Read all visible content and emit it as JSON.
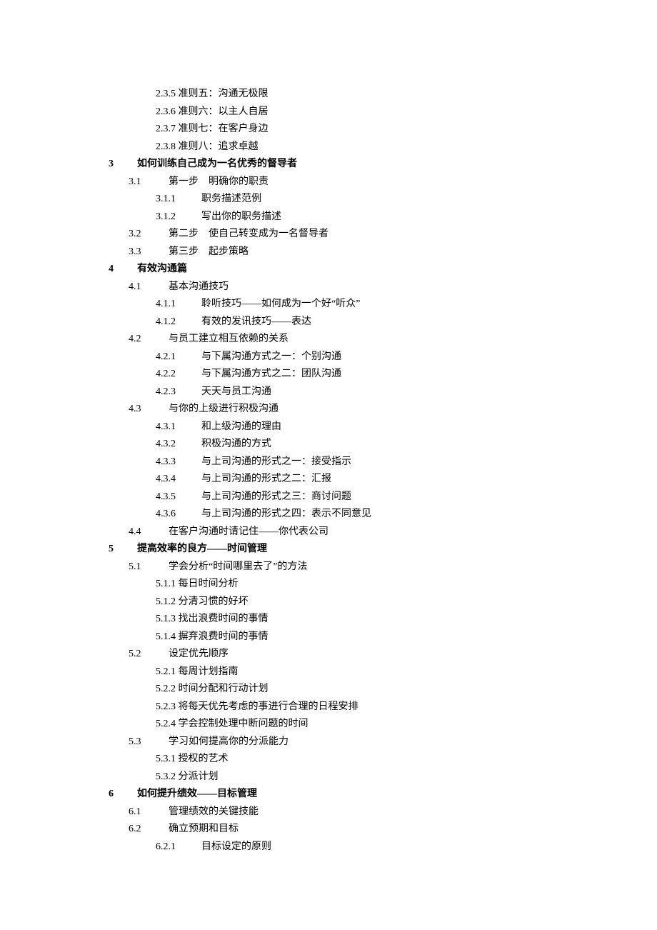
{
  "pre_items": [
    "2.3.5 准则五：沟通无极限",
    "2.3.6 准则六：以主人自居",
    "2.3.7 准则七：在客户身边",
    "2.3.8 准则八：追求卓越"
  ],
  "sections": [
    {
      "num": "3",
      "title": "如何训练自己成为一名优秀的督导者",
      "subs": [
        {
          "num": "3.1",
          "title": "第一步　明确你的职责",
          "items_style": "spaced",
          "items": [
            {
              "num": "3.1.1",
              "text": "职务描述范例"
            },
            {
              "num": "3.1.2",
              "text": "写出你的职务描述"
            }
          ]
        },
        {
          "num": "3.2",
          "title": "第二步　使自己转变成为一名督导者",
          "items": []
        },
        {
          "num": "3.3",
          "title": "第三步　起步策略",
          "items": []
        }
      ]
    },
    {
      "num": "4",
      "title": "有效沟通篇",
      "subs": [
        {
          "num": "4.1",
          "title": "基本沟通技巧",
          "items_style": "spaced",
          "items": [
            {
              "num": "4.1.1",
              "text": "聆听技巧——如何成为一个好“听众”"
            },
            {
              "num": "4.1.2",
              "text": "有效的发讯技巧——表达"
            }
          ]
        },
        {
          "num": "4.2",
          "title": "与员工建立相互依赖的关系",
          "items_style": "spaced",
          "items": [
            {
              "num": "4.2.1",
              "text": "与下属沟通方式之一：个别沟通"
            },
            {
              "num": "4.2.2",
              "text": "与下属沟通方式之二：团队沟通"
            },
            {
              "num": "4.2.3",
              "text": "天天与员工沟通"
            }
          ]
        },
        {
          "num": "4.3",
          "title": "与你的上级进行积极沟通",
          "items_style": "spaced",
          "items": [
            {
              "num": "4.3.1",
              "text": "和上级沟通的理由"
            },
            {
              "num": "4.3.2",
              "text": "积极沟通的方式"
            },
            {
              "num": "4.3.3",
              "text": "与上司沟通的形式之一：接受指示"
            },
            {
              "num": "4.3.4",
              "text": "与上司沟通的形式之二：汇报"
            },
            {
              "num": "4.3.5",
              "text": "与上司沟通的形式之三：商讨问题"
            },
            {
              "num": "4.3.6",
              "text": "与上司沟通的形式之四：表示不同意见"
            }
          ]
        },
        {
          "num": "4.4",
          "title": "在客户沟通时请记住——你代表公司",
          "items": []
        }
      ]
    },
    {
      "num": "5",
      "title": "提高效率的良方——时间管理",
      "subs": [
        {
          "num": "5.1",
          "title": "学会分析“时间哪里去了”的方法",
          "items_style": "tight",
          "items": [
            {
              "combined": "5.1.1 每日时间分析"
            },
            {
              "combined": "5.1.2 分清习惯的好坏"
            },
            {
              "combined": "5.1.3 找出浪费时间的事情"
            },
            {
              "combined": "5.1.4 摒弃浪费时间的事情"
            }
          ]
        },
        {
          "num": "5.2",
          "title": "设定优先顺序",
          "items_style": "tight",
          "items": [
            {
              "combined": "5.2.1 每周计划指南"
            },
            {
              "combined": "5.2.2 时间分配和行动计划"
            },
            {
              "combined": "5.2.3 将每天优先考虑的事进行合理的日程安排"
            },
            {
              "combined": "5.2.4 学会控制处理中断问题的时间"
            }
          ]
        },
        {
          "num": "5.3",
          "title": "学习如何提高你的分派能力",
          "items_style": "tight",
          "items": [
            {
              "combined": "5.3.1 授权的艺术"
            },
            {
              "combined": "5.3.2 分派计划"
            }
          ]
        }
      ]
    },
    {
      "num": "6",
      "title": "如何提升绩效——目标管理",
      "subs": [
        {
          "num": "6.1",
          "title": "管理绩效的关键技能",
          "items": []
        },
        {
          "num": "6.2",
          "title": "确立预期和目标",
          "items_style": "spaced",
          "items": [
            {
              "num": "6.2.1",
              "text": "目标设定的原则"
            }
          ]
        }
      ]
    }
  ]
}
